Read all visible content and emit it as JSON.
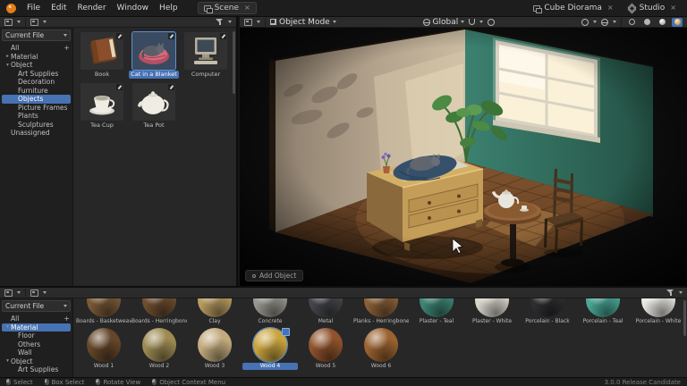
{
  "topbar": {
    "menus": [
      "File",
      "Edit",
      "Render",
      "Window",
      "Help"
    ],
    "workspace_tab": "Scene",
    "unlink_label": "×",
    "scene_name": "Cube Diorama",
    "view_layer": "Studio"
  },
  "viewport_header": {
    "mode": "Object Mode",
    "orientation": "Global"
  },
  "viewport": {
    "operator_hint": "Add Object"
  },
  "asset_browser_top": {
    "library": "Current File",
    "add_catalog_label": "+",
    "catalogs": [
      {
        "label": "All",
        "arrow": "",
        "indent": 0,
        "selected": false
      },
      {
        "label": "Material",
        "arrow": "▸",
        "indent": 0,
        "selected": false
      },
      {
        "label": "Object",
        "arrow": "▾",
        "indent": 0,
        "selected": false
      },
      {
        "label": "Art Supplies",
        "arrow": "",
        "indent": 1,
        "selected": false
      },
      {
        "label": "Decoration",
        "arrow": "",
        "indent": 1,
        "selected": false
      },
      {
        "label": "Furniture",
        "arrow": "",
        "indent": 1,
        "selected": false
      },
      {
        "label": "Objects",
        "arrow": "",
        "indent": 1,
        "selected": true
      },
      {
        "label": "Picture Frames",
        "arrow": "",
        "indent": 1,
        "selected": false
      },
      {
        "label": "Plants",
        "arrow": "",
        "indent": 1,
        "selected": false
      },
      {
        "label": "Sculptures",
        "arrow": "",
        "indent": 1,
        "selected": false
      },
      {
        "label": "Unassigned",
        "arrow": "",
        "indent": 0,
        "selected": false
      }
    ],
    "assets": [
      {
        "name": "Book",
        "selected": false
      },
      {
        "name": "Cat in a Blanket",
        "selected": true
      },
      {
        "name": "Computer",
        "selected": false
      },
      {
        "name": "Tea Cup",
        "selected": false
      },
      {
        "name": "Tea Pot",
        "selected": false
      }
    ]
  },
  "asset_browser_bottom": {
    "library": "Current File",
    "add_catalog_label": "+",
    "catalogs": [
      {
        "label": "All",
        "arrow": "",
        "indent": 0,
        "selected": false
      },
      {
        "label": "Material",
        "arrow": "▾",
        "indent": 0,
        "selected": true
      },
      {
        "label": "Floor",
        "arrow": "",
        "indent": 1,
        "selected": false
      },
      {
        "label": "Others",
        "arrow": "",
        "indent": 1,
        "selected": false
      },
      {
        "label": "Wall",
        "arrow": "",
        "indent": 1,
        "selected": false
      },
      {
        "label": "Object",
        "arrow": "▾",
        "indent": 0,
        "selected": false
      },
      {
        "label": "Art Supplies",
        "arrow": "",
        "indent": 1,
        "selected": false
      }
    ],
    "materials_row1": [
      {
        "label": "Boards - Basketweave",
        "color": "#7a5a38"
      },
      {
        "label": "Boards - Herringbone",
        "color": "#6e4e30"
      },
      {
        "label": "Clay",
        "color": "#b99c62"
      },
      {
        "label": "Concrete",
        "color": "#98968e"
      },
      {
        "label": "Metal",
        "color": "#44464a"
      },
      {
        "label": "Planks - Herringbone",
        "color": "#8a6038"
      },
      {
        "label": "Plaster - Teal",
        "color": "#3f8576"
      },
      {
        "label": "Plaster - White",
        "color": "#d9d6cc"
      },
      {
        "label": "Porcelain - Black",
        "color": "#2e2e32"
      },
      {
        "label": "Porcelain - Teal",
        "color": "#49a795"
      },
      {
        "label": "Porcelain - White",
        "color": "#e9e7e2"
      }
    ],
    "materials_row2": [
      {
        "label": "Wood 1",
        "color": "#64462a",
        "selected": false
      },
      {
        "label": "Wood 2",
        "color": "#9c8a52",
        "selected": false
      },
      {
        "label": "Wood 3",
        "color": "#c2aa7c",
        "selected": false
      },
      {
        "label": "Wood 4",
        "color": "#c9a43e",
        "selected": true
      },
      {
        "label": "Wood 5",
        "color": "#8f522c",
        "selected": false
      },
      {
        "label": "Wood 6",
        "color": "#9a6230",
        "selected": false
      }
    ]
  },
  "statusbar": {
    "items": [
      "Select",
      "Box Select",
      "Rotate View",
      "Object Context Menu"
    ],
    "version": "3.0.0 Release Candidate"
  },
  "colors": {
    "accent": "#4772b3"
  }
}
